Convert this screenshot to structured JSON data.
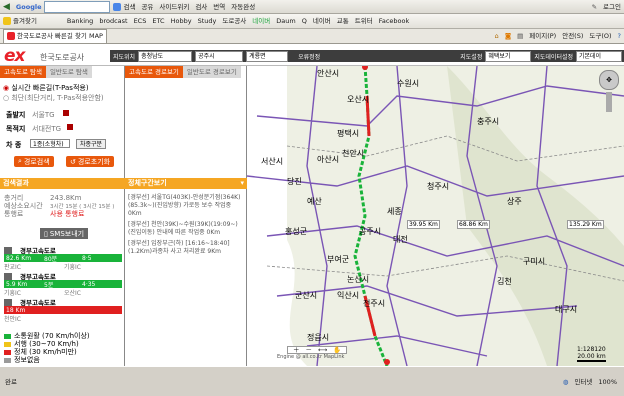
{
  "browser": {
    "google_label": "Google",
    "search_label": "검색",
    "toolbar_items": [
      "공유",
      "사이드위키",
      "검사",
      "번역",
      "자동완성"
    ],
    "login_label": "로그인",
    "bookmarks": [
      "즐겨찾기",
      "Banking",
      "brodcast",
      "ECS",
      "ETC",
      "Hobby",
      "Study",
      "도로공사",
      "네이버",
      "Daum",
      "Q",
      "네이버",
      "교통",
      "트위터",
      "Facebook"
    ],
    "tab_title": "한국도로공사 빠른길 찾기 MAP",
    "tab_tools": [
      "페이지(P)",
      "안전(S)",
      "도구(O)"
    ]
  },
  "header": {
    "logo_ex": "ex",
    "logo_name": "한국도로공사",
    "mapbar": {
      "region_label": "지도위치",
      "region_value": "충청남도",
      "city_value": "공주시",
      "town_value": "계룡면",
      "go_label": "오류정정",
      "setting_label": "지도설정",
      "setting_value": "혜택보기",
      "display_label": "지도데이터설정",
      "display_value": "기본데이"
    }
  },
  "left_panel": {
    "tab_active": "고속도로 탐색",
    "tab_inactive": "일반도로 탐색",
    "options": [
      "실시간 빠른길(T-Pas적용)",
      "최단(최단거리, T-Pas적용안함)"
    ],
    "origin_label": "출발지",
    "origin_value": "서울TG",
    "dest_label": "목적지",
    "dest_value": "서대전TG",
    "vehicle_label": "차 종",
    "vehicle_value": "1종(소형차)",
    "vehicle_button": "차종구분",
    "search_button": "경로검색",
    "reset_button": "경로초기화",
    "result_title": "검색결과",
    "result_rows": [
      {
        "k": "총거리",
        "v": "243.8Km"
      },
      {
        "k": "예상소요시간",
        "v": "3시간 15분 ( 3시간 15분 )"
      },
      {
        "k": "통행료",
        "v": "사용 통행료"
      }
    ],
    "sms_button": "SMS보내기",
    "segments": [
      {
        "route": "경부고속도로",
        "speed": "82.6 Km",
        "time": "80분",
        "sub": "8·5",
        "from": "판교IC",
        "to": "기흥IC",
        "color": "#19b33a"
      },
      {
        "route": "경부고속도로",
        "speed": "5.9 Km",
        "time": "5분",
        "sub": "4·35",
        "from": "기흥IC",
        "to": "오산IC",
        "color": "#19b33a"
      },
      {
        "route": "경부고속도로",
        "speed": "18 Km",
        "time": "",
        "sub": "",
        "from": "천안IC",
        "to": "",
        "color": "#e02020"
      }
    ],
    "legend": [
      {
        "label": "소통원활 (70 Km/h이상)",
        "color": "#19b33a"
      },
      {
        "label": "서행 (30~70 Km/h)",
        "color": "#f0c419"
      },
      {
        "label": "정체 (30 Km/h미만)",
        "color": "#e02020"
      },
      {
        "label": "정보없음",
        "color": "#9a9a9a"
      }
    ]
  },
  "middle_panel": {
    "tab_active": "고속도로 경로보기",
    "tab_inactive": "일반도로 경로보기",
    "detail_title": "정체구간보기",
    "items": [
      "[경부선] 서울TG(403K)-안성분기점(364K)(85.3k~)(진입방향) 가로등 보수 작업중 0Km",
      "[경부선] 천안(39K)~수원(39K)(19:09~)(진입이동) 안내에 따른 작업중 0Km",
      "[경부선] 입장부근(하) [16:16~18:40](1.2Km)과종차 사고 처리완료 9Km"
    ]
  },
  "map": {
    "cities": [
      "안산시",
      "오산시",
      "평택시",
      "수원시",
      "천안시",
      "아산시",
      "서산시",
      "당진",
      "예산",
      "홍성군",
      "공주시",
      "부여군",
      "논산시",
      "세종",
      "청주시",
      "충주시",
      "대전",
      "전주시",
      "익산시",
      "군산시",
      "정읍시",
      "구미시",
      "대구시",
      "상주",
      "김천"
    ],
    "distances": [
      "39.95 Km",
      "68.86 Km",
      "135.29 Km"
    ],
    "scale_ratio": "1:128120",
    "scale_km": "20.00 km",
    "copyright": "Engine @ all.co.kr MapLink"
  },
  "status": {
    "left": "완료",
    "zone": "인터넷",
    "zoom": "100%"
  }
}
